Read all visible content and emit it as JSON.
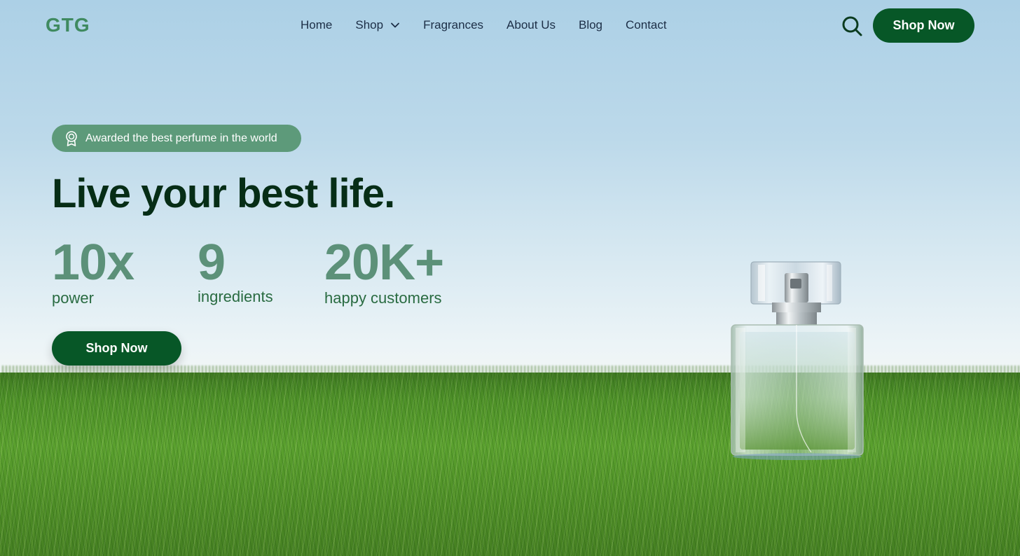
{
  "header": {
    "logo": "GTG",
    "nav": [
      {
        "label": "Home"
      },
      {
        "label": "Shop"
      },
      {
        "label": "Fragrances"
      },
      {
        "label": "About Us"
      },
      {
        "label": "Blog"
      },
      {
        "label": "Contact"
      }
    ],
    "cta_label": "Shop Now",
    "search_icon": "search-icon"
  },
  "hero": {
    "badge": "Awarded the best perfume in the world",
    "badge_icon": "award-ribbon-icon",
    "headline": "Live your best life.",
    "stats": [
      {
        "value": "10x",
        "label": "power"
      },
      {
        "value": "9",
        "label": "ingredients"
      },
      {
        "value": "20K+",
        "label": "happy customers"
      }
    ],
    "cta_label": "Shop Now"
  },
  "colors": {
    "brand_green": "#075727",
    "logo_green": "#3f8a60",
    "badge_bg": "#5d9a7a",
    "headline": "#062d16",
    "stat_number": "#5c9179"
  }
}
